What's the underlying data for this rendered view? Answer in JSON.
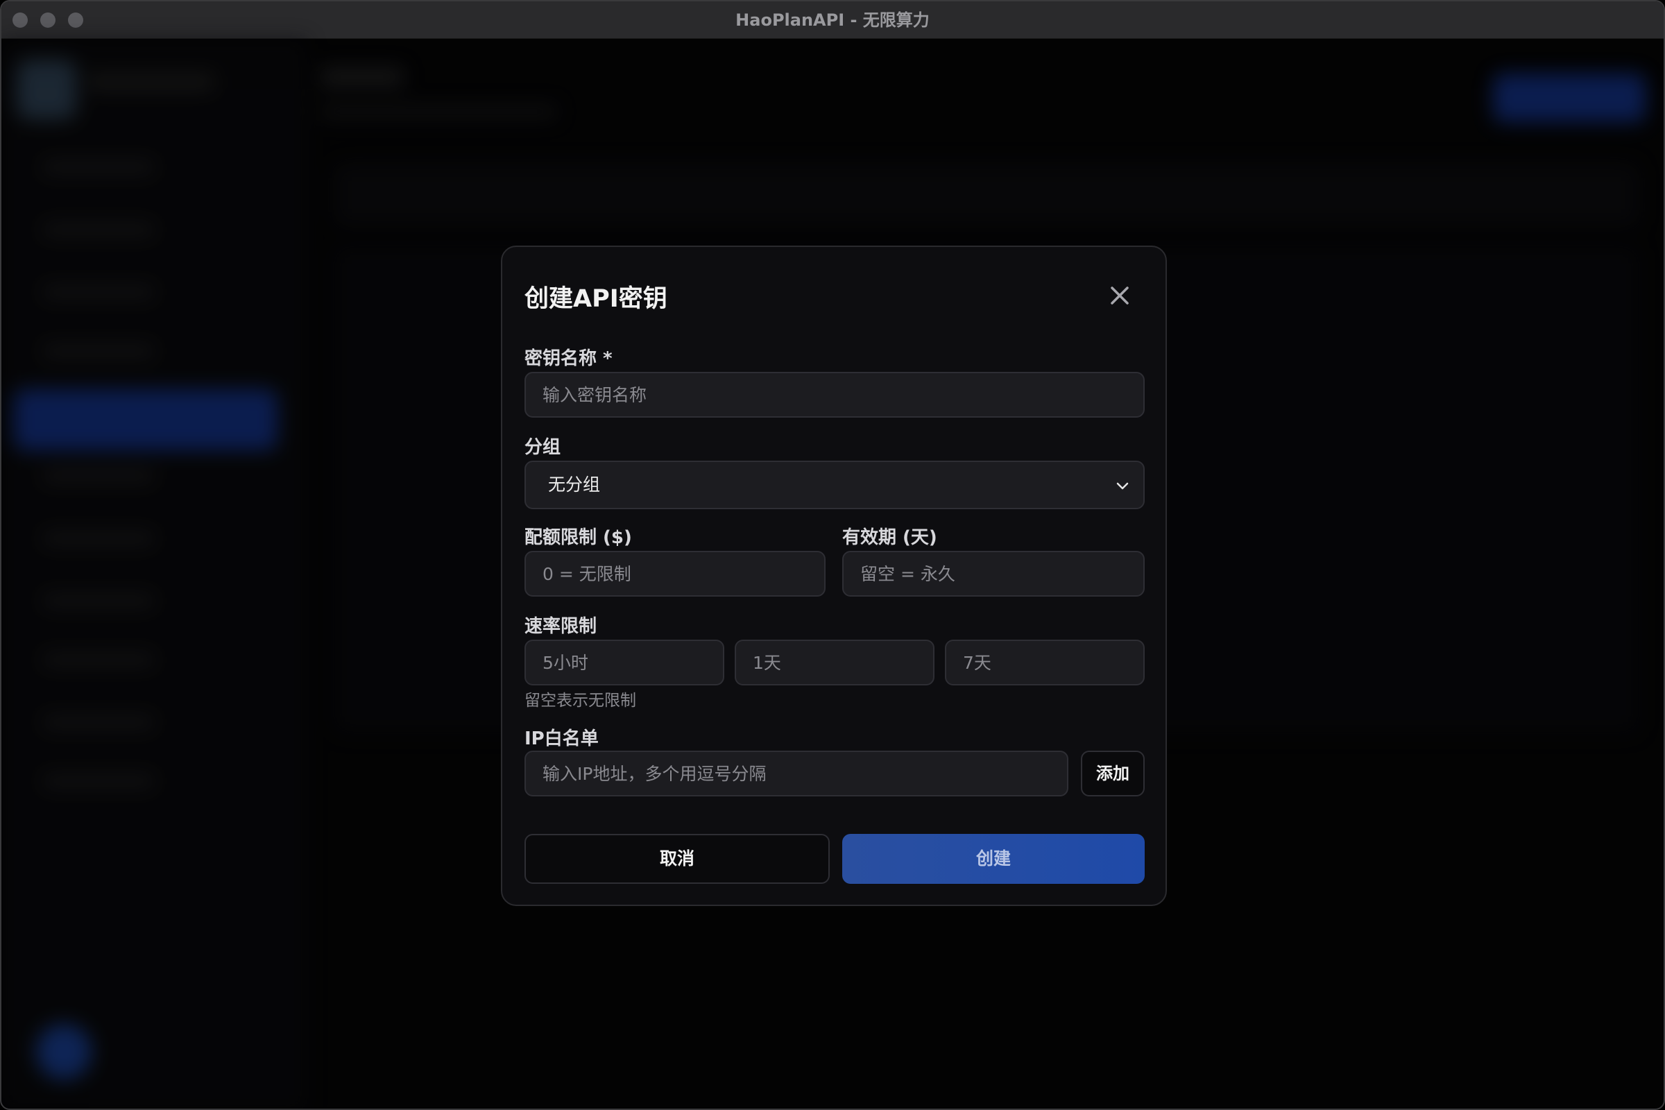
{
  "window": {
    "title": "HaoPlanAPI - 无限算力"
  },
  "modal": {
    "title": "创建API密钥",
    "fields": {
      "key_name": {
        "label": "密钥名称 *",
        "placeholder": "输入密钥名称",
        "value": ""
      },
      "group": {
        "label": "分组",
        "selected": "无分组"
      },
      "quota": {
        "label": "配额限制 ($)",
        "placeholder": "0 = 无限制"
      },
      "expiry": {
        "label": "有效期 (天)",
        "placeholder": "留空 = 永久"
      },
      "rate_limit": {
        "label": "速率限制",
        "placeholder_5h": "5小时",
        "placeholder_1d": "1天",
        "placeholder_7d": "7天",
        "hint": "留空表示无限制"
      },
      "ip_whitelist": {
        "label": "IP白名单",
        "placeholder": "输入IP地址，多个用逗号分隔",
        "add_label": "添加"
      }
    },
    "buttons": {
      "cancel": "取消",
      "create": "创建"
    }
  },
  "colors": {
    "accent": "#1f4aa8",
    "background": "#0d0d10"
  }
}
